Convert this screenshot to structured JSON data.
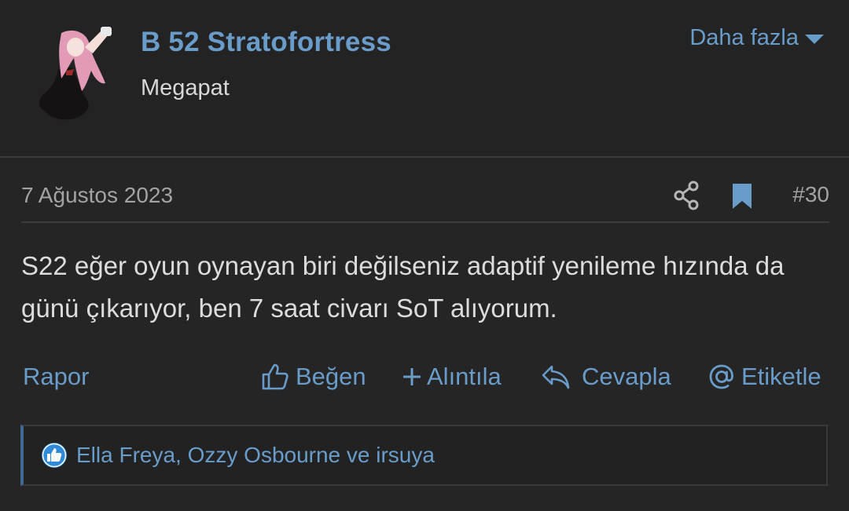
{
  "user": {
    "name": "B 52 Stratofortress",
    "title": "Megapat",
    "more_label": "Daha fazla"
  },
  "post": {
    "date": "7 Ağustos 2023",
    "number": "#30",
    "body": "S22 eğer oyun oynayan biri değilseniz adaptif yenileme hızında da günü çıkarıyor, ben 7 saat civarı SoT alıyorum."
  },
  "actions": {
    "report": "Rapor",
    "like": "Beğen",
    "quote": "Alıntıla",
    "reply": "Cevapla",
    "tag": "Etiketle"
  },
  "reactions": {
    "text": "Ella Freya, Ozzy Osbourne ve irsuya"
  },
  "icons": {
    "share": "share-icon",
    "bookmark": "bookmark-icon",
    "like": "thumbs-up-icon",
    "quote": "plus-icon",
    "reply": "reply-icon",
    "tag": "at-icon",
    "reaction": "like-reaction-icon"
  },
  "colors": {
    "accent": "#6a9cc9",
    "background": "#252526",
    "text": "#dcdcdc",
    "muted": "#a3a3a3"
  }
}
